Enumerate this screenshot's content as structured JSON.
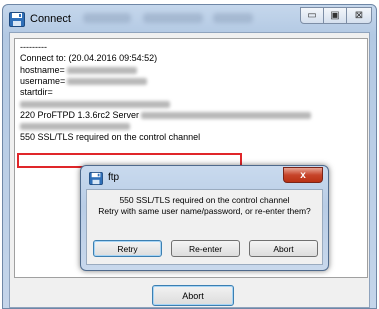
{
  "window": {
    "title": "Connect",
    "minimize_glyph": "▭",
    "maximize_glyph": "▣",
    "close_glyph": "⊠"
  },
  "log": {
    "lines": [
      "---------",
      "Connect to: (20.04.2016 09:54:52)",
      "hostname=",
      "username=",
      "startdir=",
      "",
      "220 ProFTPD 1.3.6rc2 Server",
      "",
      "550 SSL/TLS required on the control channel"
    ]
  },
  "footer": {
    "abort_label": "Abort"
  },
  "dialog": {
    "title": "ftp",
    "close_glyph": "x",
    "message_line1": "550 SSL/TLS required on the control channel",
    "message_line2": "Retry with same user name/password, or re-enter them?",
    "buttons": {
      "retry": "Retry",
      "reenter": "Re-enter",
      "abort": "Abort"
    }
  },
  "colors": {
    "highlight_border": "#e0262a",
    "close_button": "#c7442a",
    "default_button_border": "#3c7fb1"
  },
  "icons": {
    "app": "floppy-disk-icon"
  }
}
